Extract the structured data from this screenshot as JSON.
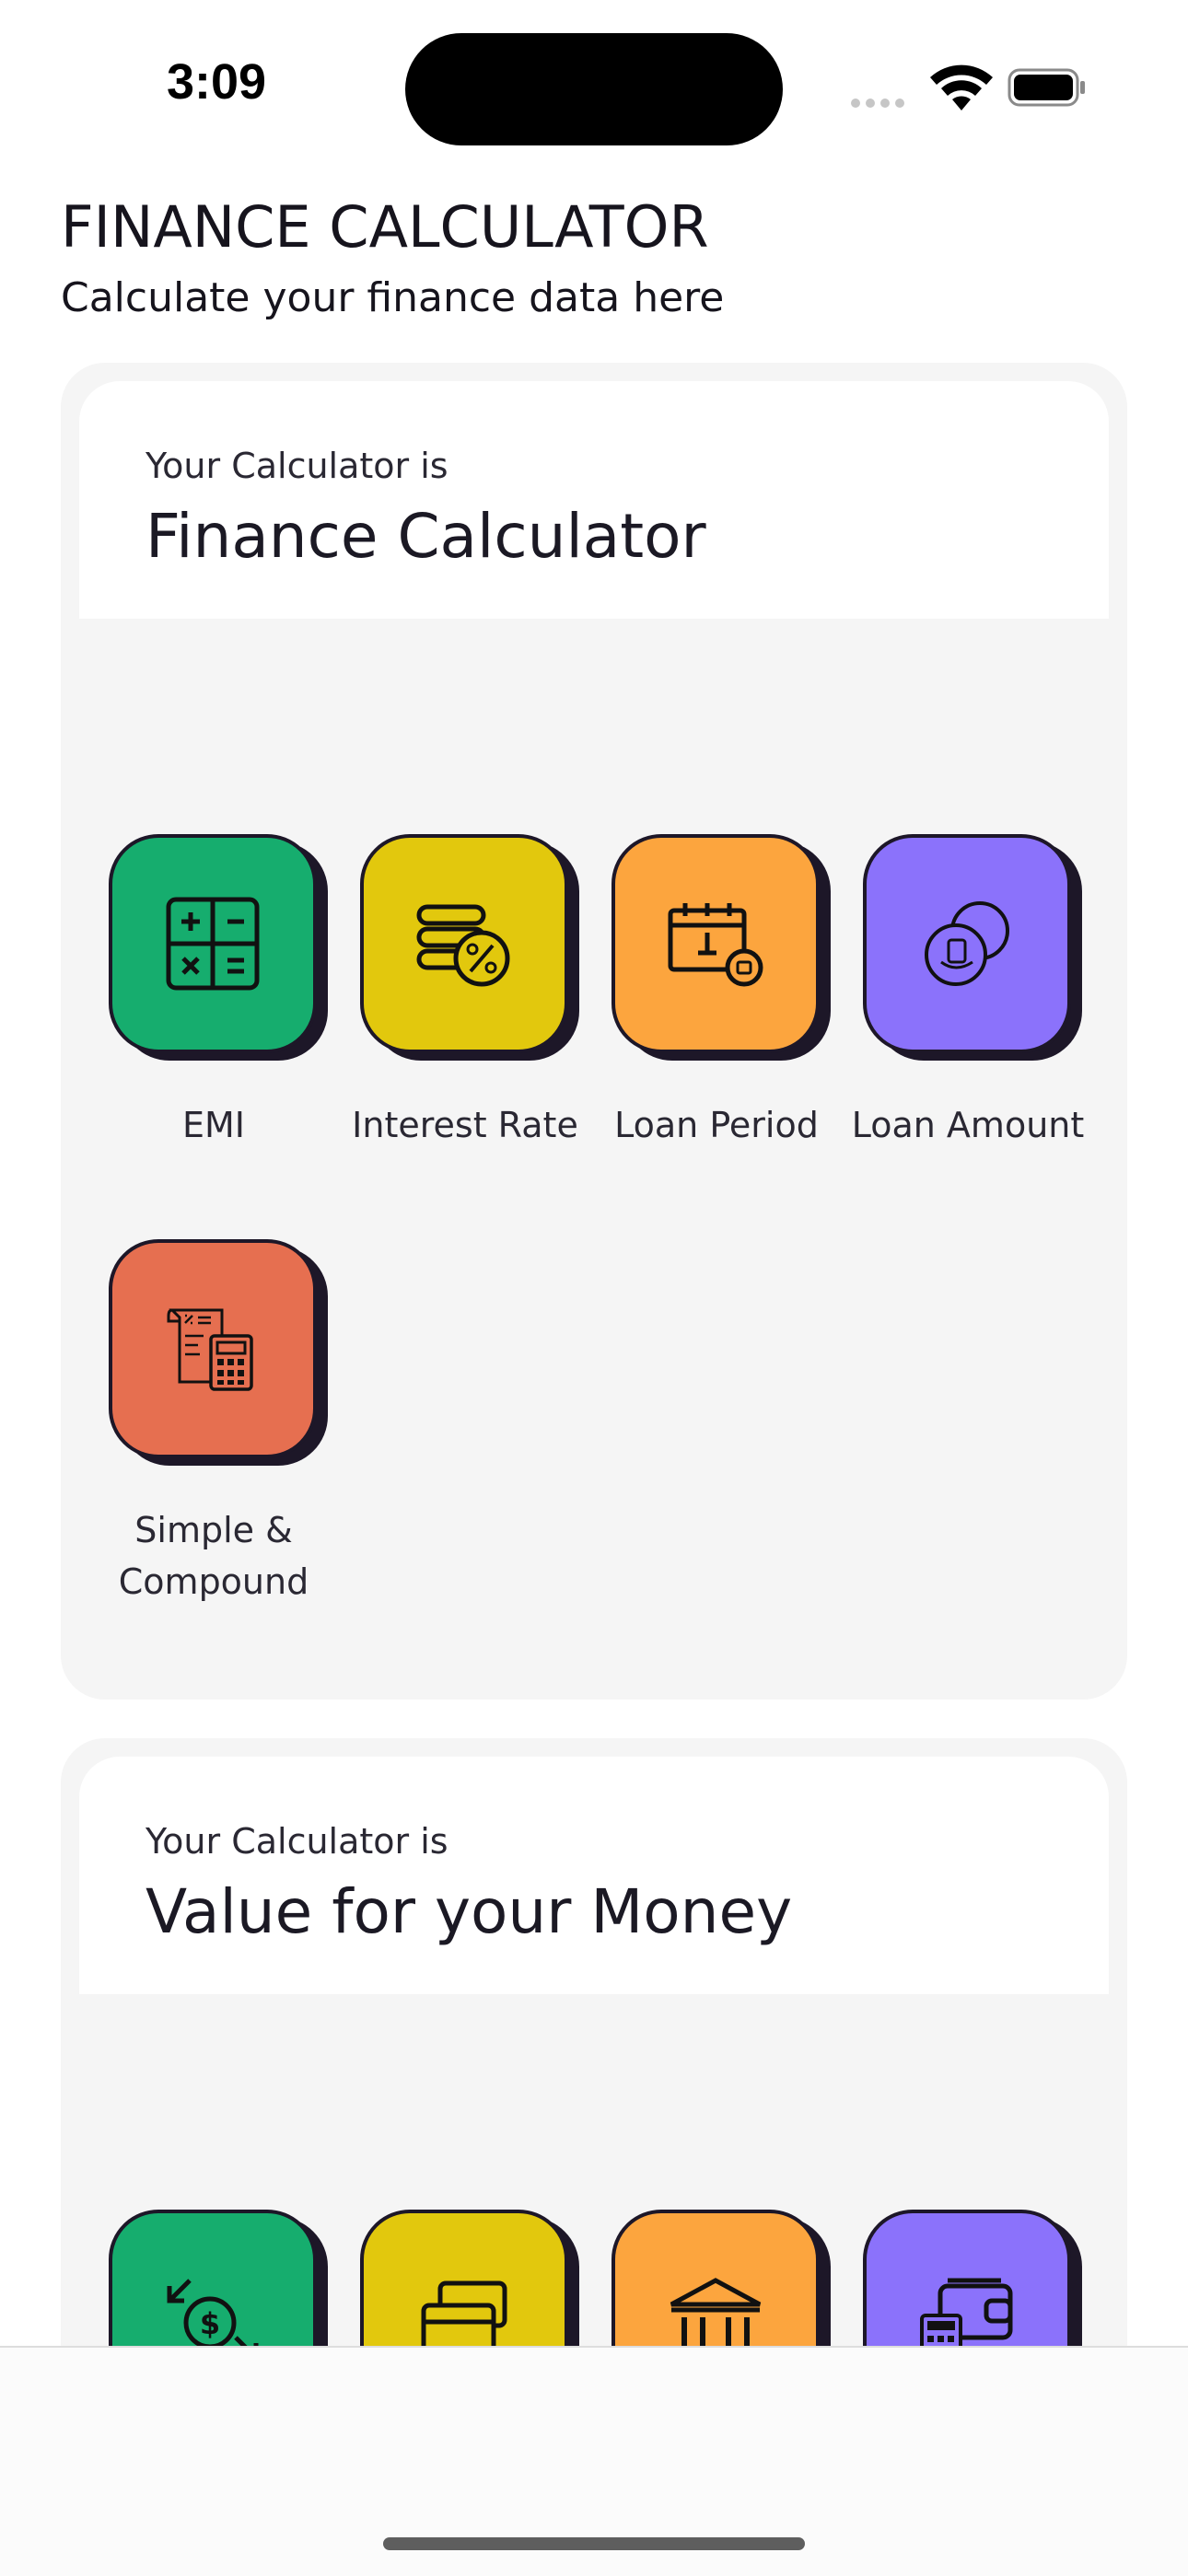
{
  "status_bar": {
    "time": "3:09"
  },
  "header": {
    "title": "FINANCE CALCULATOR",
    "subtitle": "Calculate your finance data here"
  },
  "sections": [
    {
      "kicker": "Your Calculator is",
      "title": "Finance Calculator",
      "items": [
        {
          "label": "EMI",
          "color": "#16ad6e",
          "icon": "calculator-grid-icon"
        },
        {
          "label": "Interest Rate",
          "color": "#e2c80d",
          "icon": "coins-percent-icon"
        },
        {
          "label": "Loan Period",
          "color": "#fca53e",
          "icon": "calendar-icon"
        },
        {
          "label": "Loan Amount",
          "color": "#8b72fb",
          "icon": "coins-icon"
        },
        {
          "label": "Simple & Compound",
          "color": "#e66f50",
          "icon": "receipt-calculator-icon"
        }
      ]
    },
    {
      "kicker": "Your Calculator is",
      "title": "Value for your Money",
      "items": [
        {
          "color": "#16ad6e",
          "icon": "currency-exchange-icon"
        },
        {
          "color": "#e2c80d",
          "icon": "credit-cards-icon"
        },
        {
          "color": "#fca53e",
          "icon": "bank-icon"
        },
        {
          "color": "#8b72fb",
          "icon": "wallet-calculator-icon"
        }
      ]
    }
  ]
}
